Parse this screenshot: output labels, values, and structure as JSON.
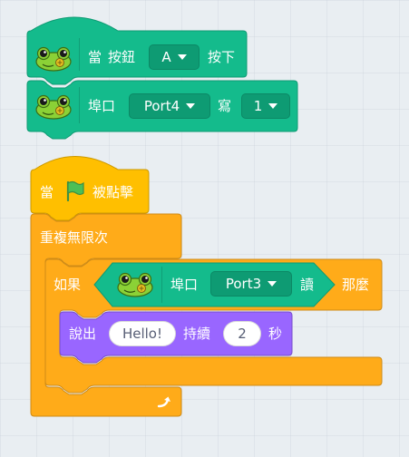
{
  "colors": {
    "ext_green": "#14bb8c",
    "ext_green_dark": "#0e9b73",
    "events_yellow": "#ffbf00",
    "control_orange": "#ffab19",
    "looks_purple": "#9966ff",
    "flag_green": "#4cbf56"
  },
  "block_button": {
    "icon": "frog-icon",
    "when": "當",
    "button_label": "按鈕",
    "button_value": "A",
    "pressed": "按下"
  },
  "block_write": {
    "icon": "frog-icon",
    "port_label": "埠口",
    "port_value": "Port4",
    "write_label": "寫",
    "write_value": "1"
  },
  "block_flag": {
    "when": "當",
    "icon": "green-flag-icon",
    "clicked": "被點擊"
  },
  "block_forever": {
    "label": "重複無限次",
    "icon": "loop-arrow-icon"
  },
  "block_if": {
    "if_label": "如果",
    "then_label": "那麼",
    "condition": {
      "icon": "frog-icon",
      "port_label": "埠口",
      "port_value": "Port3",
      "read_label": "讀"
    }
  },
  "block_say": {
    "say_label": "說出",
    "message": "Hello!",
    "for_label": "持續",
    "seconds": "2",
    "seconds_unit": "秒"
  }
}
